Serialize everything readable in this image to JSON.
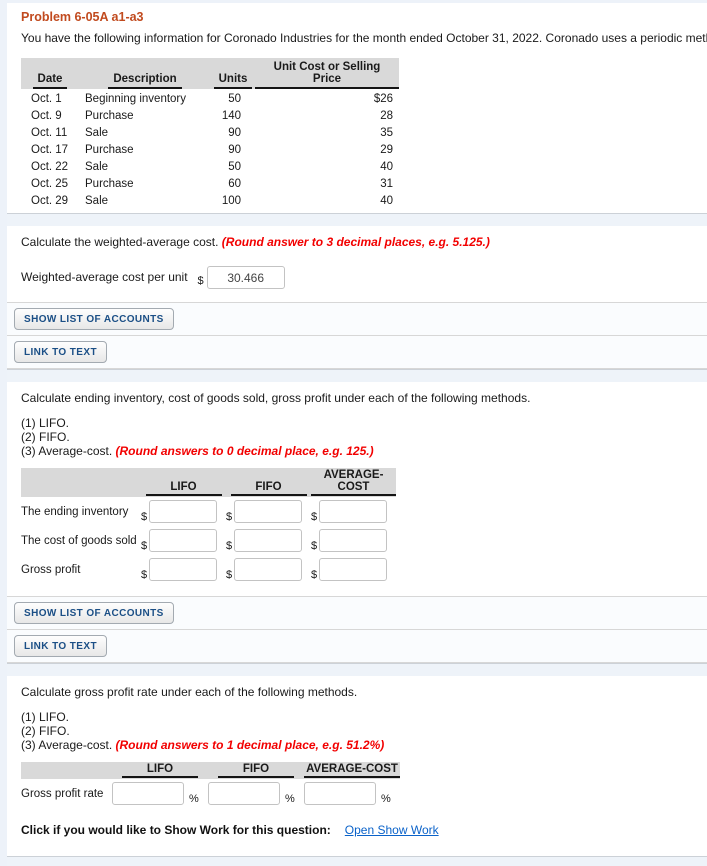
{
  "colors": {
    "title": "#c14a1e",
    "note": "#f20000",
    "link": "#0a62c9",
    "button": "#1b4f86"
  },
  "header": {
    "title": "Problem 6-05A a1-a3",
    "intro": "You have the following information for Coronado Industries for the month ended October 31, 2022. Coronado uses a periodic method for inven"
  },
  "inventory_table": {
    "headers": {
      "date": "Date",
      "description": "Description",
      "units": "Units",
      "price": "Unit Cost or Selling Price"
    },
    "rows": [
      {
        "date": "Oct. 1",
        "description": "Beginning inventory",
        "units": "50",
        "price": "$26"
      },
      {
        "date": "Oct. 9",
        "description": "Purchase",
        "units": "140",
        "price": "28"
      },
      {
        "date": "Oct. 11",
        "description": "Sale",
        "units": "90",
        "price": "35"
      },
      {
        "date": "Oct. 17",
        "description": "Purchase",
        "units": "90",
        "price": "29"
      },
      {
        "date": "Oct. 22",
        "description": "Sale",
        "units": "50",
        "price": "40"
      },
      {
        "date": "Oct. 25",
        "description": "Purchase",
        "units": "60",
        "price": "31"
      },
      {
        "date": "Oct. 29",
        "description": "Sale",
        "units": "100",
        "price": "40"
      }
    ]
  },
  "buttons": {
    "show_list": "SHOW LIST OF ACCOUNTS",
    "link_to_text": "LINK TO TEXT"
  },
  "part_a1": {
    "prompt": "Calculate the weighted-average cost. ",
    "note": "(Round answer to 3 decimal places, e.g. 5.125.)",
    "field_label": "Weighted-average cost per unit",
    "currency": "$",
    "value": "30.466"
  },
  "part_a2": {
    "prompt": "Calculate ending inventory, cost of goods sold, gross profit under each of the following methods.",
    "list_1": "(1) LIFO.",
    "list_2": "(2) FIFO.",
    "list_3": "(3) Average-cost. ",
    "note": "(Round answers to 0 decimal place, e.g. 125.)",
    "columns": {
      "lifo": "LIFO",
      "fifo": "FIFO",
      "avg": "AVERAGE-COST"
    },
    "row_labels": {
      "ending_inventory": "The ending inventory",
      "cogs": "The cost of goods sold",
      "gross_profit": "Gross profit"
    },
    "currency": "$"
  },
  "part_a3": {
    "prompt": "Calculate gross profit rate under each of the following methods.",
    "list_1": "(1) LIFO.",
    "list_2": "(2) FIFO.",
    "list_3": "(3) Average-cost. ",
    "note": "(Round answers to 1 decimal place, e.g. 51.2%)",
    "columns": {
      "lifo": "LIFO",
      "fifo": "FIFO",
      "avg": "AVERAGE-COST"
    },
    "row_label": "Gross profit rate",
    "percent": "%",
    "show_work_label": "Click if you would like to Show Work for this question:",
    "show_work_link": "Open Show Work"
  }
}
